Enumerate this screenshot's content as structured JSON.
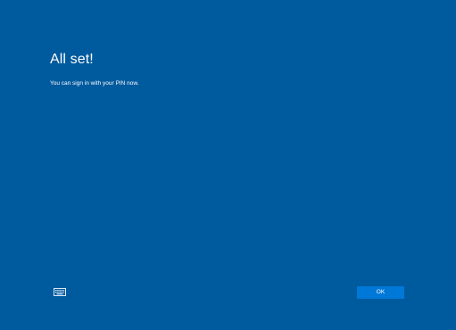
{
  "dialog": {
    "title": "All set!",
    "message": "You can sign in with your PIN now."
  },
  "footer": {
    "keyboard_icon": "keyboard-icon",
    "ok_label": "OK"
  },
  "colors": {
    "background": "#005a9e",
    "button": "#0078d7",
    "text": "#ffffff"
  }
}
